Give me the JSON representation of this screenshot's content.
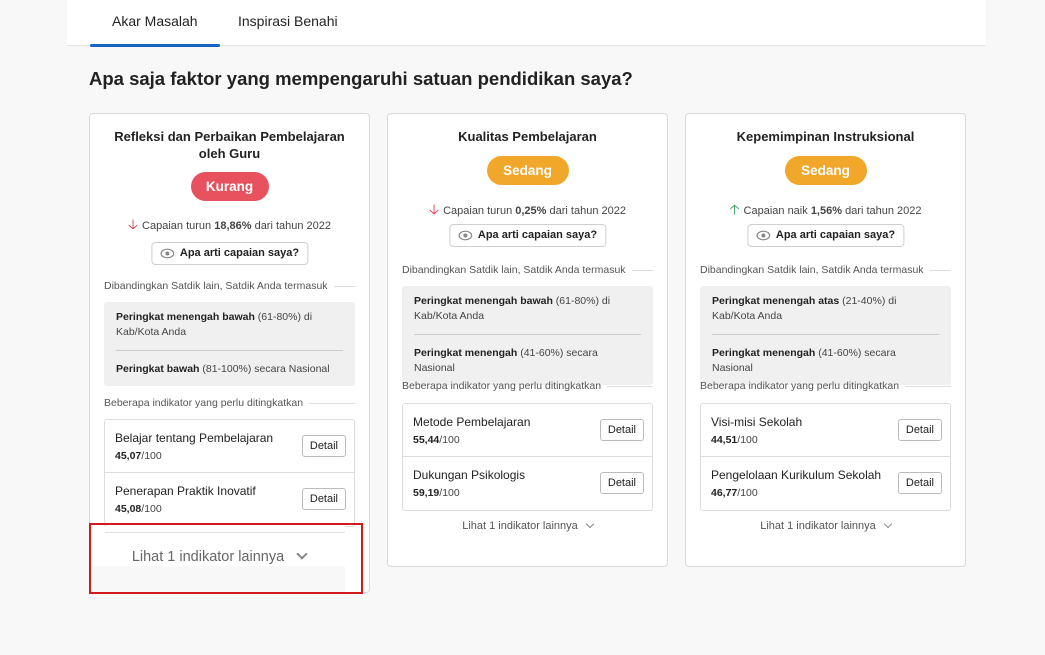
{
  "tabs": [
    {
      "label": "Akar Masalah",
      "active": true
    },
    {
      "label": "Inspirasi Benahi",
      "active": false
    }
  ],
  "page_title": "Apa saja faktor yang mempengaruhi satuan pendidikan saya?",
  "colors": {
    "accent": "#1565c0",
    "badge_kurang": "#e8525f",
    "badge_sedang": "#f0a72a",
    "trend_down": "#d9303d",
    "trend_up": "#2e9e5b",
    "highlight": "#d11a1a"
  },
  "cards": [
    {
      "title": "Refleksi dan Perbaikan Pembelajaran oleh Guru",
      "badge": "Kurang",
      "trend": {
        "direction": "down",
        "icon": "arrow-down-icon",
        "prefix": "Capaian turun ",
        "value": "18,86%",
        "suffix": " dari tahun 2022"
      },
      "info_button": "Apa arti capaian saya?",
      "compare_label": "Dibandingkan Satdik lain, Satdik Anda termasuk",
      "ranks": [
        {
          "bold": "Peringkat menengah bawah",
          "rest": " (61-80%) di Kab/Kota Anda"
        },
        {
          "bold": "Peringkat bawah",
          "rest": " (81-100%) secara Nasional"
        }
      ],
      "indicators_label": "Beberapa indikator yang perlu ditingkatkan",
      "indicators": [
        {
          "name": "Belajar tentang Pembelajaran",
          "score": "45,07",
          "max": "/100",
          "button": "Detail"
        },
        {
          "name": "Penerapan Praktik Inovatif",
          "score": "45,08",
          "max": "/100",
          "button": "Detail"
        }
      ],
      "more_link": "Lihat 1 indikator lainnya"
    },
    {
      "title": "Kualitas Pembelajaran",
      "badge": "Sedang",
      "trend": {
        "direction": "down",
        "icon": "arrow-down-icon",
        "prefix": "Capaian turun ",
        "value": "0,25%",
        "suffix": " dari tahun 2022"
      },
      "info_button": "Apa arti capaian saya?",
      "compare_label": "Dibandingkan Satdik lain, Satdik Anda termasuk",
      "ranks": [
        {
          "bold": "Peringkat menengah bawah",
          "rest": " (61-80%) di Kab/Kota Anda"
        },
        {
          "bold": "Peringkat menengah",
          "rest": " (41-60%) secara Nasional"
        }
      ],
      "indicators_label": "Beberapa indikator yang perlu ditingkatkan",
      "indicators": [
        {
          "name": "Metode Pembelajaran",
          "score": "55,44",
          "max": "/100",
          "button": "Detail"
        },
        {
          "name": "Dukungan Psikologis",
          "score": "59,19",
          "max": "/100",
          "button": "Detail"
        }
      ],
      "more_link": "Lihat 1 indikator lainnya"
    },
    {
      "title": "Kepemimpinan Instruksional",
      "badge": "Sedang",
      "trend": {
        "direction": "up",
        "icon": "arrow-up-icon",
        "prefix": "Capaian naik ",
        "value": "1,56%",
        "suffix": " dari tahun 2022"
      },
      "info_button": "Apa arti capaian saya?",
      "compare_label": "Dibandingkan Satdik lain, Satdik Anda termasuk",
      "ranks": [
        {
          "bold": "Peringkat menengah atas",
          "rest": " (21-40%) di Kab/Kota Anda"
        },
        {
          "bold": "Peringkat menengah",
          "rest": " (41-60%) secara Nasional"
        }
      ],
      "indicators_label": "Beberapa indikator yang perlu ditingkatkan",
      "indicators": [
        {
          "name": "Visi-misi Sekolah",
          "score": "44,51",
          "max": "/100",
          "button": "Detail"
        },
        {
          "name": "Pengelolaan Kurikulum Sekolah",
          "score": "46,77",
          "max": "/100",
          "button": "Detail"
        }
      ],
      "more_link": "Lihat 1 indikator lainnya"
    }
  ],
  "zoom_callout": {
    "text": "Lihat 1 indikator lainnya"
  }
}
